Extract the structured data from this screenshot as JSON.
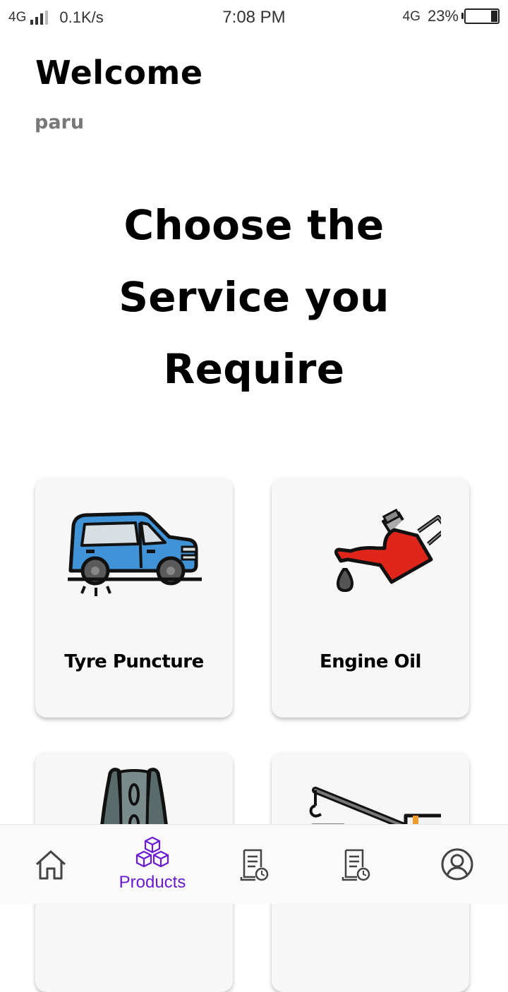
{
  "status_bar": {
    "network": "4G",
    "speed": "0.1K/s",
    "time": "7:08 PM",
    "data_type": "4G",
    "battery": "23%"
  },
  "header": {
    "welcome": "Welcome",
    "username": "paru"
  },
  "headline": "Choose the Service you Require",
  "services": [
    {
      "label": "Tyre Puncture",
      "icon": "car-icon"
    },
    {
      "label": "Engine Oil",
      "icon": "oil-can-icon"
    },
    {
      "label": "",
      "icon": "belt-icon"
    },
    {
      "label": "",
      "icon": "tow-truck-icon"
    }
  ],
  "bottom_nav": {
    "items": [
      {
        "label": "",
        "icon": "home-icon"
      },
      {
        "label": "Products",
        "icon": "boxes-icon",
        "active": true
      },
      {
        "label": "",
        "icon": "order-history-icon"
      },
      {
        "label": "",
        "icon": "order-history-icon"
      },
      {
        "label": "",
        "icon": "profile-icon"
      }
    ]
  },
  "colors": {
    "accent": "#6a1bd1",
    "car_body": "#3f93d6",
    "oil_can": "#e0261a"
  }
}
